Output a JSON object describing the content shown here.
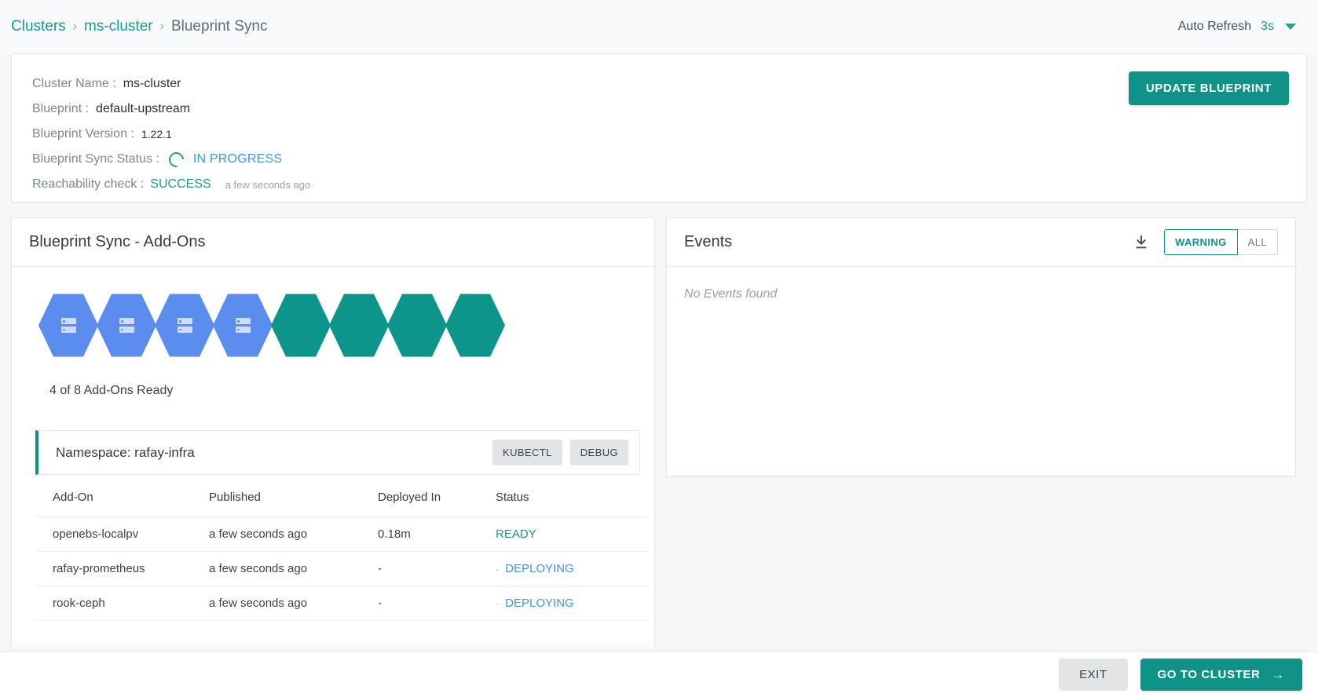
{
  "breadcrumb": {
    "items": [
      {
        "label": "Clusters",
        "link": true
      },
      {
        "label": "ms-cluster",
        "link": true
      },
      {
        "label": "Blueprint Sync",
        "link": false
      }
    ],
    "separator": "›"
  },
  "auto_refresh": {
    "label": "Auto Refresh",
    "value": "3s"
  },
  "cluster_info": {
    "rows": [
      {
        "label": "Cluster Name :",
        "value": "ms-cluster"
      },
      {
        "label": "Blueprint :",
        "value": "default-upstream"
      },
      {
        "label": "Blueprint Version :",
        "value": "1.22.1"
      }
    ],
    "sync_status": {
      "label": "Blueprint Sync Status :",
      "value": "IN PROGRESS"
    },
    "reachability": {
      "label": "Reachability check :",
      "value": "SUCCESS",
      "ago": "a few seconds ago"
    },
    "update_button": "UPDATE BLUEPRINT"
  },
  "addons_panel": {
    "title": "Blueprint Sync - Add-Ons",
    "hexes": [
      {
        "state": "deploying",
        "color": "#5b8def",
        "icon": "server-rack-icon"
      },
      {
        "state": "deploying",
        "color": "#5b8def",
        "icon": "server-rack-icon"
      },
      {
        "state": "deploying",
        "color": "#5b8def",
        "icon": "server-rack-icon"
      },
      {
        "state": "deploying",
        "color": "#5b8def",
        "icon": "server-rack-icon"
      },
      {
        "state": "ready",
        "color": "#0c958a",
        "icon": ""
      },
      {
        "state": "ready",
        "color": "#0c958a",
        "icon": ""
      },
      {
        "state": "ready",
        "color": "#0c958a",
        "icon": ""
      },
      {
        "state": "ready",
        "color": "#0c958a",
        "icon": ""
      }
    ],
    "ready_count_text": "4 of 8 Add-Ons Ready",
    "namespace": {
      "title": "Namespace: rafay-infra",
      "kubectl_label": "KUBECTL",
      "debug_label": "DEBUG"
    },
    "table": {
      "columns": [
        "Add-On",
        "Published",
        "Deployed In",
        "Status"
      ],
      "rows": [
        {
          "addon": "openebs-localpv",
          "published": "a few seconds ago",
          "deployed_in": "0.18m",
          "status": "READY",
          "status_kind": "ready"
        },
        {
          "addon": "rafay-prometheus",
          "published": "a few seconds ago",
          "deployed_in": "-",
          "status": "DEPLOYING",
          "status_kind": "deploying"
        },
        {
          "addon": "rook-ceph",
          "published": "a few seconds ago",
          "deployed_in": "-",
          "status": "DEPLOYING",
          "status_kind": "deploying"
        }
      ]
    }
  },
  "events_panel": {
    "title": "Events",
    "download_icon": "download-icon",
    "filters": [
      {
        "label": "WARNING",
        "active": true
      },
      {
        "label": "ALL",
        "active": false
      }
    ],
    "empty_text": "No Events found"
  },
  "footer": {
    "exit_label": "EXIT",
    "goto_label": "GO TO CLUSTER",
    "goto_arrow": "→"
  },
  "colors": {
    "accent_teal": "#0f9287",
    "link_blue": "#3b96e8",
    "hex_blue": "#5b8def",
    "hex_teal": "#0c958a",
    "page_bg": "#f5f7f9"
  }
}
